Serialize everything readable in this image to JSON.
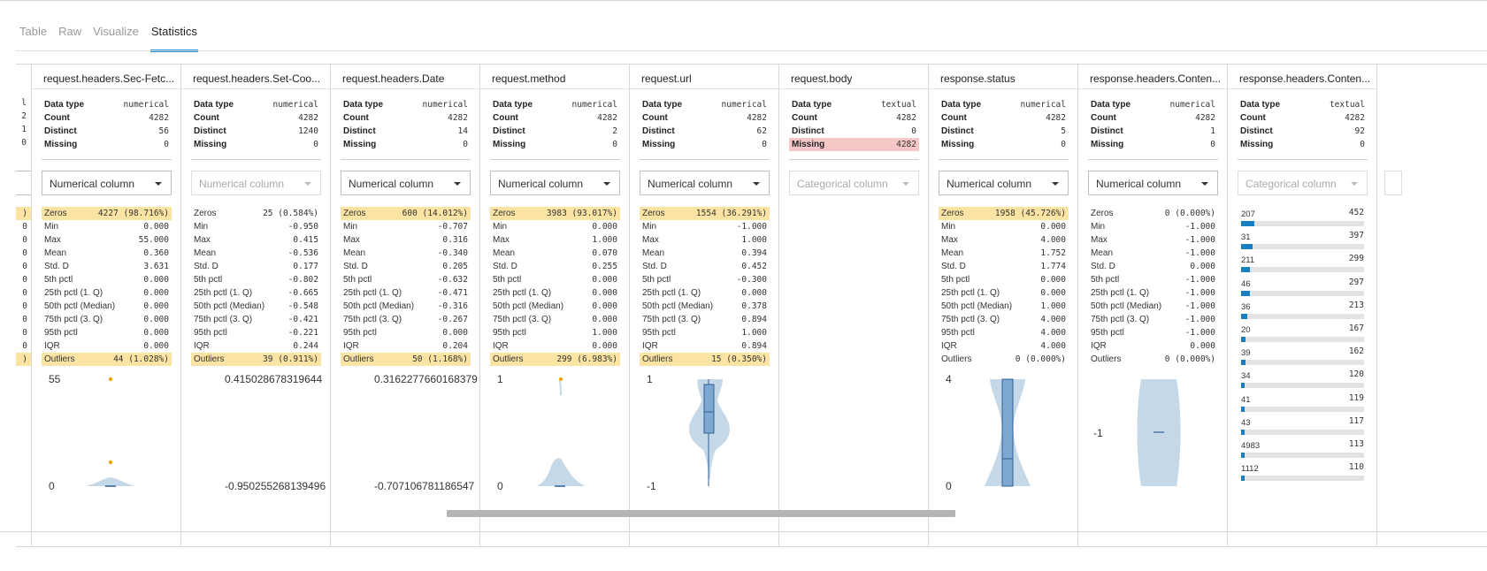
{
  "tabs": [
    "Table",
    "Raw",
    "Visualize",
    "Statistics"
  ],
  "active_tab": 3,
  "partial_left": {
    "summary": [
      "l",
      "2",
      "1",
      "0"
    ],
    "stats": [
      ")",
      "0",
      "0",
      "0",
      "0",
      "0",
      "0",
      "0",
      "0",
      "0",
      "0",
      ")"
    ]
  },
  "labels": {
    "data_type": "Data type",
    "count": "Count",
    "distinct": "Distinct",
    "missing": "Missing",
    "zeros": "Zeros",
    "min": "Min",
    "max": "Max",
    "mean": "Mean",
    "std": "Std. D",
    "p5": "5th pctl",
    "p25": "25th pctl (1. Q)",
    "p50": "50th pctl (Median)",
    "p75": "75th pctl (3. Q)",
    "p95": "95th pctl",
    "iqr": "IQR",
    "outliers": "Outliers"
  },
  "columns": [
    {
      "name": "request.headers.Sec-Fetc...",
      "dtype": "numerical",
      "count": "4282",
      "distinct": "56",
      "missing": "0",
      "dropdown": "Numerical column",
      "dropdown_disabled": false,
      "stats": {
        "zeros": "4227 (98.716%)",
        "min": "0.000",
        "max": "55.000",
        "mean": "0.360",
        "std": "3.631",
        "p5": "0.000",
        "p25": "0.000",
        "p50": "0.000",
        "p75": "0.000",
        "p95": "0.000",
        "iqr": "0.000",
        "outliers": "44 (1.028%)"
      },
      "highlight": [
        "zeros",
        "outliers"
      ],
      "viz": {
        "type": "violin-flat",
        "max_label": "55",
        "min_label": "0"
      }
    },
    {
      "name": "request.headers.Set-Coo...",
      "dtype": "numerical",
      "count": "4282",
      "distinct": "1240",
      "missing": "0",
      "dropdown": "Numerical column",
      "dropdown_disabled": true,
      "stats": {
        "zeros": "25 (0.584%)",
        "min": "-0.950",
        "max": "0.415",
        "mean": "-0.536",
        "std": "0.177",
        "p5": "-0.802",
        "p25": "-0.665",
        "p50": "-0.548",
        "p75": "-0.421",
        "p95": "-0.221",
        "iqr": "0.244",
        "outliers": "39 (0.911%)"
      },
      "highlight": [
        "outliers"
      ],
      "viz": {
        "type": "labels-only",
        "max_label": "0.415028678319644",
        "min_label": "-0.950255268139496"
      }
    },
    {
      "name": "request.headers.Date",
      "dtype": "numerical",
      "count": "4282",
      "distinct": "14",
      "missing": "0",
      "dropdown": "Numerical column",
      "dropdown_disabled": false,
      "stats": {
        "zeros": "600 (14.012%)",
        "min": "-0.707",
        "max": "0.316",
        "mean": "-0.340",
        "std": "0.205",
        "p5": "-0.632",
        "p25": "-0.471",
        "p50": "-0.316",
        "p75": "-0.267",
        "p95": "0.000",
        "iqr": "0.204",
        "outliers": "50 (1.168%)"
      },
      "highlight": [
        "zeros",
        "outliers"
      ],
      "viz": {
        "type": "labels-only",
        "max_label": "0.3162277660168379",
        "min_label": "-0.707106781186547"
      }
    },
    {
      "name": "request.method",
      "dtype": "numerical",
      "count": "4282",
      "distinct": "2",
      "missing": "0",
      "dropdown": "Numerical column",
      "dropdown_disabled": false,
      "stats": {
        "zeros": "3983 (93.017%)",
        "min": "0.000",
        "max": "1.000",
        "mean": "0.070",
        "std": "0.255",
        "p5": "0.000",
        "p25": "0.000",
        "p50": "0.000",
        "p75": "0.000",
        "p95": "1.000",
        "iqr": "0.000",
        "outliers": "299 (6.983%)"
      },
      "highlight": [
        "zeros",
        "outliers"
      ],
      "viz": {
        "type": "violin-low",
        "max_label": "1",
        "min_label": "0"
      }
    },
    {
      "name": "request.url",
      "dtype": "numerical",
      "count": "4282",
      "distinct": "62",
      "missing": "0",
      "dropdown": "Numerical column",
      "dropdown_disabled": false,
      "stats": {
        "zeros": "1554 (36.291%)",
        "min": "-1.000",
        "max": "1.000",
        "mean": "0.394",
        "std": "0.452",
        "p5": "-0.300",
        "p25": "0.000",
        "p50": "0.378",
        "p75": "0.894",
        "p95": "1.000",
        "iqr": "0.894",
        "outliers": "15 (0.350%)"
      },
      "highlight": [
        "zeros",
        "outliers"
      ],
      "viz": {
        "type": "violin-url",
        "max_label": "1",
        "min_label": "-1"
      }
    },
    {
      "name": "request.body",
      "dtype": "textual",
      "count": "4282",
      "distinct": "0",
      "missing": "4282",
      "missing_highlight": true,
      "dropdown": "Categorical column",
      "dropdown_disabled": true,
      "stats": null,
      "highlight": [],
      "viz": {
        "type": "none"
      }
    },
    {
      "name": "response.status",
      "dtype": "numerical",
      "count": "4282",
      "distinct": "5",
      "missing": "0",
      "dropdown": "Numerical column",
      "dropdown_disabled": false,
      "stats": {
        "zeros": "1958 (45.726%)",
        "min": "0.000",
        "max": "4.000",
        "mean": "1.752",
        "std": "1.774",
        "p5": "0.000",
        "p25": "0.000",
        "p50": "1.000",
        "p75": "4.000",
        "p95": "4.000",
        "iqr": "4.000",
        "outliers": "0 (0.000%)"
      },
      "highlight": [
        "zeros"
      ],
      "viz": {
        "type": "violin-status",
        "max_label": "4",
        "min_label": "0"
      }
    },
    {
      "name": "response.headers.Conten...",
      "dtype": "numerical",
      "count": "4282",
      "distinct": "1",
      "missing": "0",
      "dropdown": "Numerical column",
      "dropdown_disabled": false,
      "stats": {
        "zeros": "0 (0.000%)",
        "min": "-1.000",
        "max": "-1.000",
        "mean": "-1.000",
        "std": "0.000",
        "p5": "-1.000",
        "p25": "-1.000",
        "p50": "-1.000",
        "p75": "-1.000",
        "p95": "-1.000",
        "iqr": "0.000",
        "outliers": "0 (0.000%)"
      },
      "highlight": [],
      "viz": {
        "type": "violin-const",
        "mid_label": "-1"
      }
    },
    {
      "name": "response.headers.Conten...",
      "dtype": "textual",
      "count": "4282",
      "distinct": "92",
      "missing": "0",
      "dropdown": "Categorical column",
      "dropdown_disabled": true,
      "stats": null,
      "highlight": [],
      "viz": {
        "type": "categories"
      },
      "categories": [
        {
          "label": "207",
          "value": 452
        },
        {
          "label": "31",
          "value": 397
        },
        {
          "label": "211",
          "value": 299
        },
        {
          "label": "46",
          "value": 297
        },
        {
          "label": "36",
          "value": 213
        },
        {
          "label": "20",
          "value": 167
        },
        {
          "label": "39",
          "value": 162
        },
        {
          "label": "34",
          "value": 120
        },
        {
          "label": "41",
          "value": 119
        },
        {
          "label": "43",
          "value": 117
        },
        {
          "label": "4983",
          "value": 113
        },
        {
          "label": "1112",
          "value": 110
        }
      ],
      "category_total": 4282
    }
  ],
  "colors": {
    "accent": "#1e8ccc",
    "highlight": "#fbe3a3",
    "missing": "#f6c7c7",
    "violin": "#c5d8e8",
    "box": "#7ea7d1",
    "outlier": "#f0a500",
    "bar": "#1a7fc0"
  }
}
